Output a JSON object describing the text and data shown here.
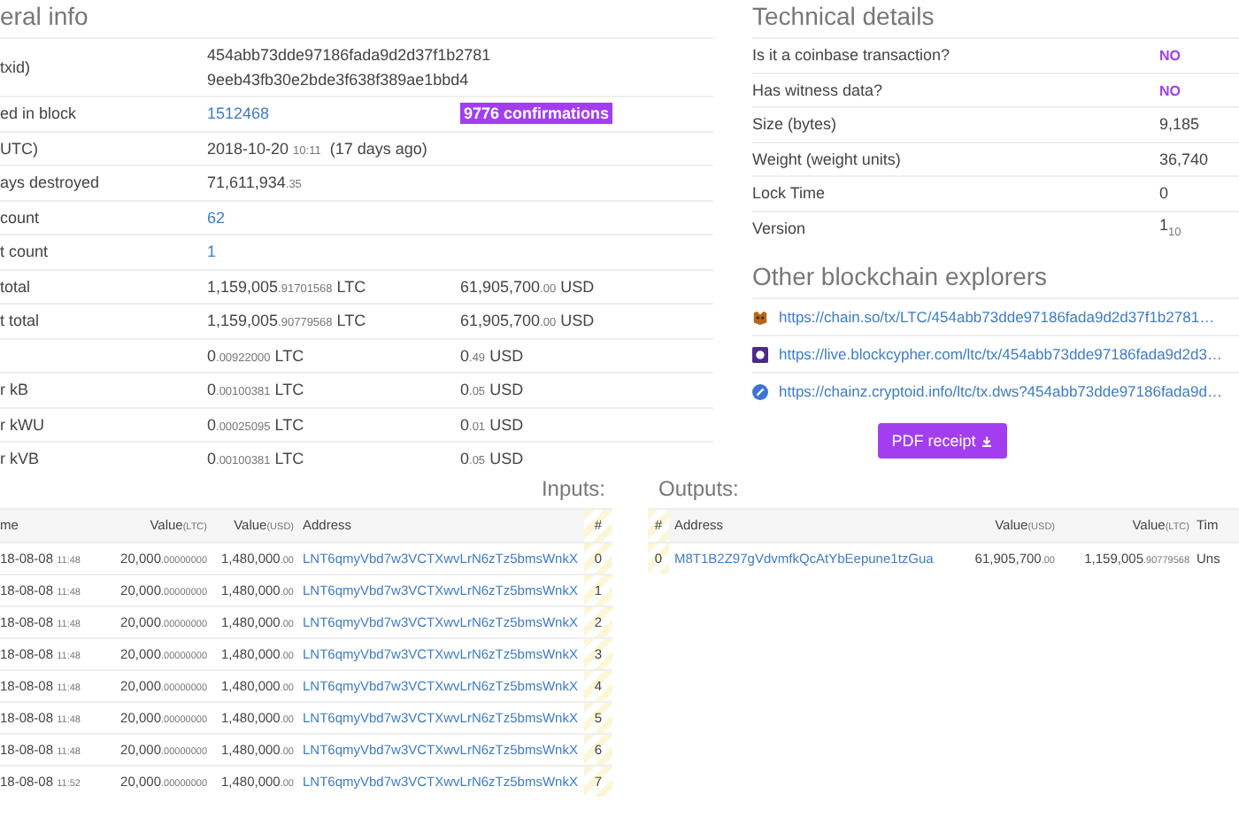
{
  "general": {
    "title": "eral info",
    "rows": [
      {
        "label": "txid)",
        "kind": "hash",
        "lines": [
          "454abb73dde97186fada9d2d37f1b2781",
          "9eeb43fb30e2bde3f638f389ae1bbd4"
        ]
      },
      {
        "label": "ed in block",
        "kind": "block",
        "link": "1512468",
        "badge": "9776 confirmations"
      },
      {
        "label": "UTC)",
        "kind": "date",
        "date": "2018-10-20",
        "time": "10:11",
        "ago": "(17 days ago)"
      },
      {
        "label": "ays destroyed",
        "kind": "plain",
        "main": "71,611,934",
        "small": ".35"
      },
      {
        "label": "count",
        "kind": "link",
        "link": "62"
      },
      {
        "label": "t count",
        "kind": "link",
        "link": "1"
      },
      {
        "label": "total",
        "kind": "amount",
        "ltc": {
          "main": "1,159,005",
          "small": ".91701568",
          "unit": "LTC"
        },
        "usd": {
          "main": "61,905,700",
          "small": ".00",
          "unit": "USD"
        }
      },
      {
        "label": "t total",
        "kind": "amount",
        "ltc": {
          "main": "1,159,005",
          "small": ".90779568",
          "unit": "LTC"
        },
        "usd": {
          "main": "61,905,700",
          "small": ".00",
          "unit": "USD"
        }
      },
      {
        "label": "",
        "kind": "amount",
        "ltc": {
          "main": "0",
          "small": ".00922000",
          "unit": "LTC"
        },
        "usd": {
          "main": "0",
          "small": ".49",
          "unit": "USD"
        }
      },
      {
        "label": "r kB",
        "kind": "amount",
        "ltc": {
          "main": "0",
          "small": ".00100381",
          "unit": "LTC"
        },
        "usd": {
          "main": "0",
          "small": ".05",
          "unit": "USD"
        }
      },
      {
        "label": "r kWU",
        "kind": "amount",
        "ltc": {
          "main": "0",
          "small": ".00025095",
          "unit": "LTC"
        },
        "usd": {
          "main": "0",
          "small": ".01",
          "unit": "USD"
        }
      },
      {
        "label": "r kVB",
        "kind": "amount",
        "ltc": {
          "main": "0",
          "small": ".00100381",
          "unit": "LTC"
        },
        "usd": {
          "main": "0",
          "small": ".05",
          "unit": "USD"
        }
      }
    ]
  },
  "technical": {
    "title": "Technical details",
    "rows": [
      {
        "label": "Is it a coinbase transaction?",
        "kind": "flag",
        "value": "NO"
      },
      {
        "label": "Has witness data?",
        "kind": "flag",
        "value": "NO"
      },
      {
        "label": "Size (bytes)",
        "kind": "plain",
        "value": "9,185"
      },
      {
        "label": "Weight (weight units)",
        "kind": "plain",
        "value": "36,740"
      },
      {
        "label": "Lock Time",
        "kind": "plain",
        "value": "0"
      },
      {
        "label": "Version",
        "kind": "version",
        "value": "1",
        "sub": "10"
      }
    ]
  },
  "explorers": {
    "title": "Other blockchain explorers",
    "links": [
      {
        "kind": "dog",
        "url": "https://chain.so/tx/LTC/454abb73dde97186fada9d2d37f1b2781…"
      },
      {
        "kind": "cube",
        "url": "https://live.blockcypher.com/ltc/tx/454abb73dde97186fada9d2d3…"
      },
      {
        "kind": "pen",
        "url": "https://chainz.cryptoid.info/ltc/tx.dws?454abb73dde97186fada9d…"
      }
    ],
    "button": "PDF receipt"
  },
  "inputs": {
    "title": "Inputs:",
    "columns": [
      {
        "label": "me"
      },
      {
        "label": "Value",
        "unit": "(LTC)"
      },
      {
        "label": "Value",
        "unit": "(USD)"
      },
      {
        "label": "Address"
      },
      {
        "label": "#"
      }
    ],
    "rows": [
      {
        "date": "18-08-08",
        "time": "11:48",
        "ltc": "20,000",
        "ltc_small": ".00000000",
        "usd": "1,480,000",
        "usd_small": ".00",
        "address": "LNT6qmyVbd7w3VCTXwvLrN6zTz5bmsWnkX",
        "index": "0"
      },
      {
        "date": "18-08-08",
        "time": "11:48",
        "ltc": "20,000",
        "ltc_small": ".00000000",
        "usd": "1,480,000",
        "usd_small": ".00",
        "address": "LNT6qmyVbd7w3VCTXwvLrN6zTz5bmsWnkX",
        "index": "1"
      },
      {
        "date": "18-08-08",
        "time": "11:48",
        "ltc": "20,000",
        "ltc_small": ".00000000",
        "usd": "1,480,000",
        "usd_small": ".00",
        "address": "LNT6qmyVbd7w3VCTXwvLrN6zTz5bmsWnkX",
        "index": "2"
      },
      {
        "date": "18-08-08",
        "time": "11:48",
        "ltc": "20,000",
        "ltc_small": ".00000000",
        "usd": "1,480,000",
        "usd_small": ".00",
        "address": "LNT6qmyVbd7w3VCTXwvLrN6zTz5bmsWnkX",
        "index": "3"
      },
      {
        "date": "18-08-08",
        "time": "11:48",
        "ltc": "20,000",
        "ltc_small": ".00000000",
        "usd": "1,480,000",
        "usd_small": ".00",
        "address": "LNT6qmyVbd7w3VCTXwvLrN6zTz5bmsWnkX",
        "index": "4"
      },
      {
        "date": "18-08-08",
        "time": "11:48",
        "ltc": "20,000",
        "ltc_small": ".00000000",
        "usd": "1,480,000",
        "usd_small": ".00",
        "address": "LNT6qmyVbd7w3VCTXwvLrN6zTz5bmsWnkX",
        "index": "5"
      },
      {
        "date": "18-08-08",
        "time": "11:48",
        "ltc": "20,000",
        "ltc_small": ".00000000",
        "usd": "1,480,000",
        "usd_small": ".00",
        "address": "LNT6qmyVbd7w3VCTXwvLrN6zTz5bmsWnkX",
        "index": "6"
      },
      {
        "date": "18-08-08",
        "time": "11:52",
        "ltc": "20,000",
        "ltc_small": ".00000000",
        "usd": "1,480,000",
        "usd_small": ".00",
        "address": "LNT6qmyVbd7w3VCTXwvLrN6zTz5bmsWnkX",
        "index": "7"
      }
    ]
  },
  "outputs": {
    "title": "Outputs:",
    "columns": [
      {
        "label": "#"
      },
      {
        "label": "Address"
      },
      {
        "label": "Value",
        "unit": "(USD)"
      },
      {
        "label": "Value",
        "unit": "(LTC)"
      },
      {
        "label": "Tim"
      }
    ],
    "rows": [
      {
        "index": "0",
        "address": "M8T1B2Z97gVdvmfkQcAtYbEepune1tzGua",
        "usd": "61,905,700",
        "usd_small": ".00",
        "ltc": "1,159,005",
        "ltc_small": ".90779568",
        "time": "Uns"
      }
    ]
  }
}
